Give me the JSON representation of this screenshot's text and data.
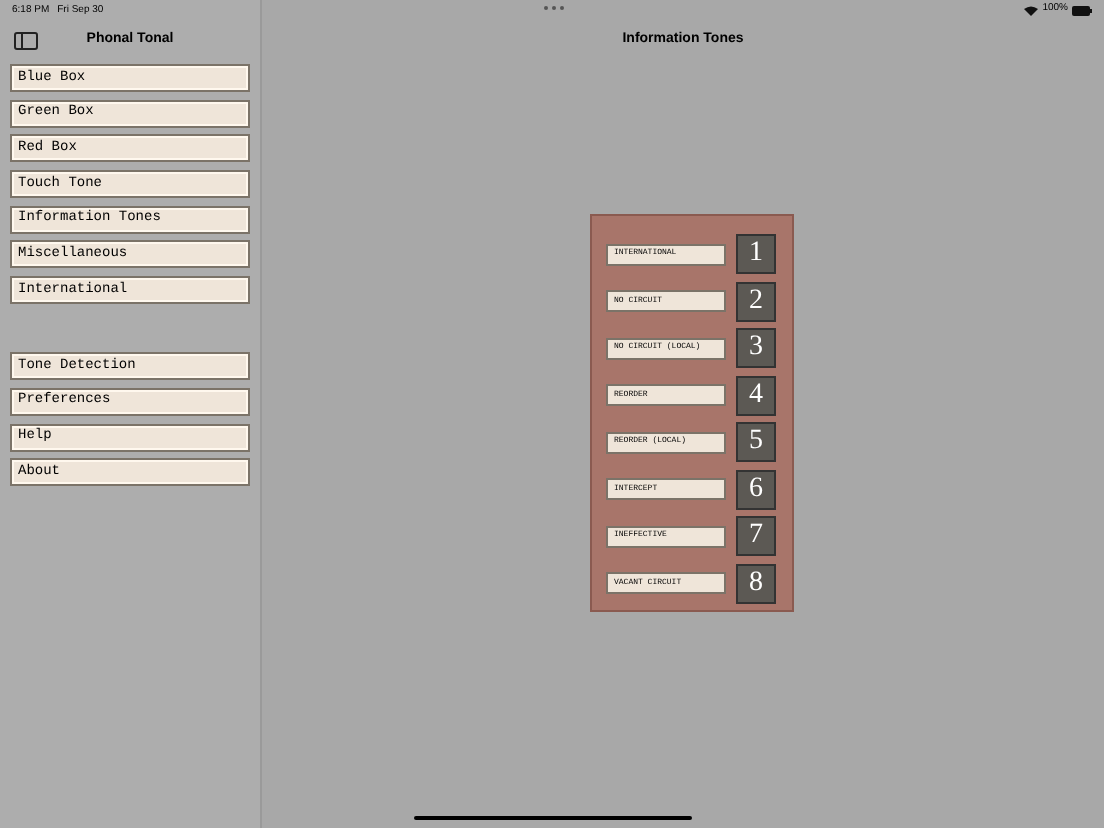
{
  "status_bar": {
    "time": "6:18 PM",
    "date": "Fri Sep 30",
    "battery": "100%"
  },
  "sidebar": {
    "title": "Phonal Tonal",
    "groups": [
      {
        "items": [
          "Blue Box",
          "Green Box",
          "Red Box",
          "Touch Tone",
          "Information Tones",
          "Miscellaneous",
          "International"
        ]
      },
      {
        "items": [
          "Tone Detection",
          "Preferences",
          "Help",
          "About"
        ]
      }
    ]
  },
  "main": {
    "title": "Information Tones",
    "tones": [
      {
        "label": "INTERNATIONAL",
        "number": "1"
      },
      {
        "label": "NO CIRCUIT",
        "number": "2"
      },
      {
        "label": "NO CIRCUIT (LOCAL)",
        "number": "3"
      },
      {
        "label": "REORDER",
        "number": "4"
      },
      {
        "label": "REORDER (LOCAL)",
        "number": "5"
      },
      {
        "label": "INTERCEPT",
        "number": "6"
      },
      {
        "label": "INEFFECTIVE",
        "number": "7"
      },
      {
        "label": "VACANT CIRCUIT",
        "number": "8"
      }
    ]
  }
}
